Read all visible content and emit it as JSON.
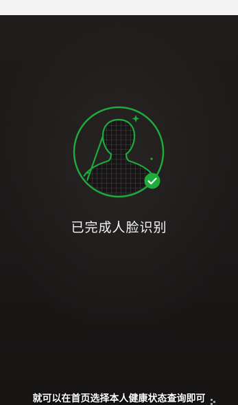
{
  "status": {
    "message": "已完成人脸识别"
  },
  "caption": {
    "text": "就可以在首页选择本人健康状态查询即可"
  },
  "icons": {
    "face": "face-scan-icon",
    "check": "check-circle-icon"
  },
  "colors": {
    "accent": "#1faa3c",
    "background": "#1c1919",
    "text": "#f2f2f2"
  }
}
